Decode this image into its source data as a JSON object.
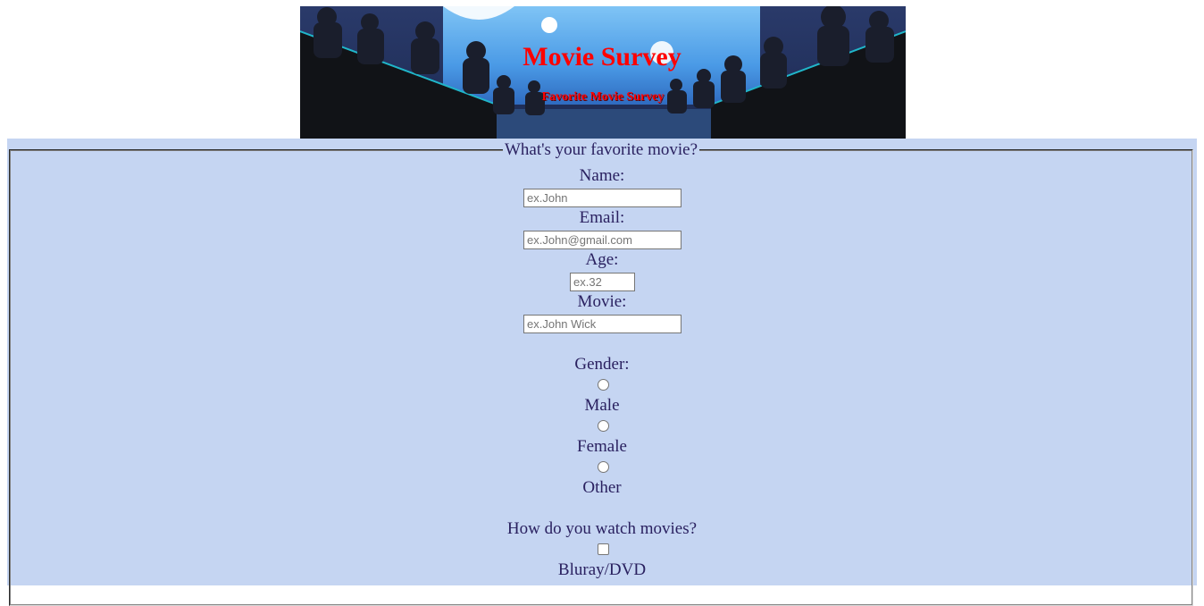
{
  "banner": {
    "title": "Movie Survey",
    "subtitle": "Favorite Movie Survey"
  },
  "form": {
    "legend": "What's your favorite movie?",
    "name_label": "Name:",
    "name_placeholder": "ex.John",
    "email_label": "Email:",
    "email_placeholder": "ex.John@gmail.com",
    "age_label": "Age:",
    "age_placeholder": "ex.32",
    "movie_label": "Movie:",
    "movie_placeholder": "ex.John Wick",
    "gender_label": "Gender:",
    "gender_options": [
      "Male",
      "Female",
      "Other"
    ],
    "watch_label": "How do you watch movies?",
    "watch_options": [
      "Bluray/DVD"
    ]
  },
  "colors": {
    "panel_bg": "#c5d5f2",
    "label_text": "#2a2160",
    "banner_text": "#ff0000"
  }
}
